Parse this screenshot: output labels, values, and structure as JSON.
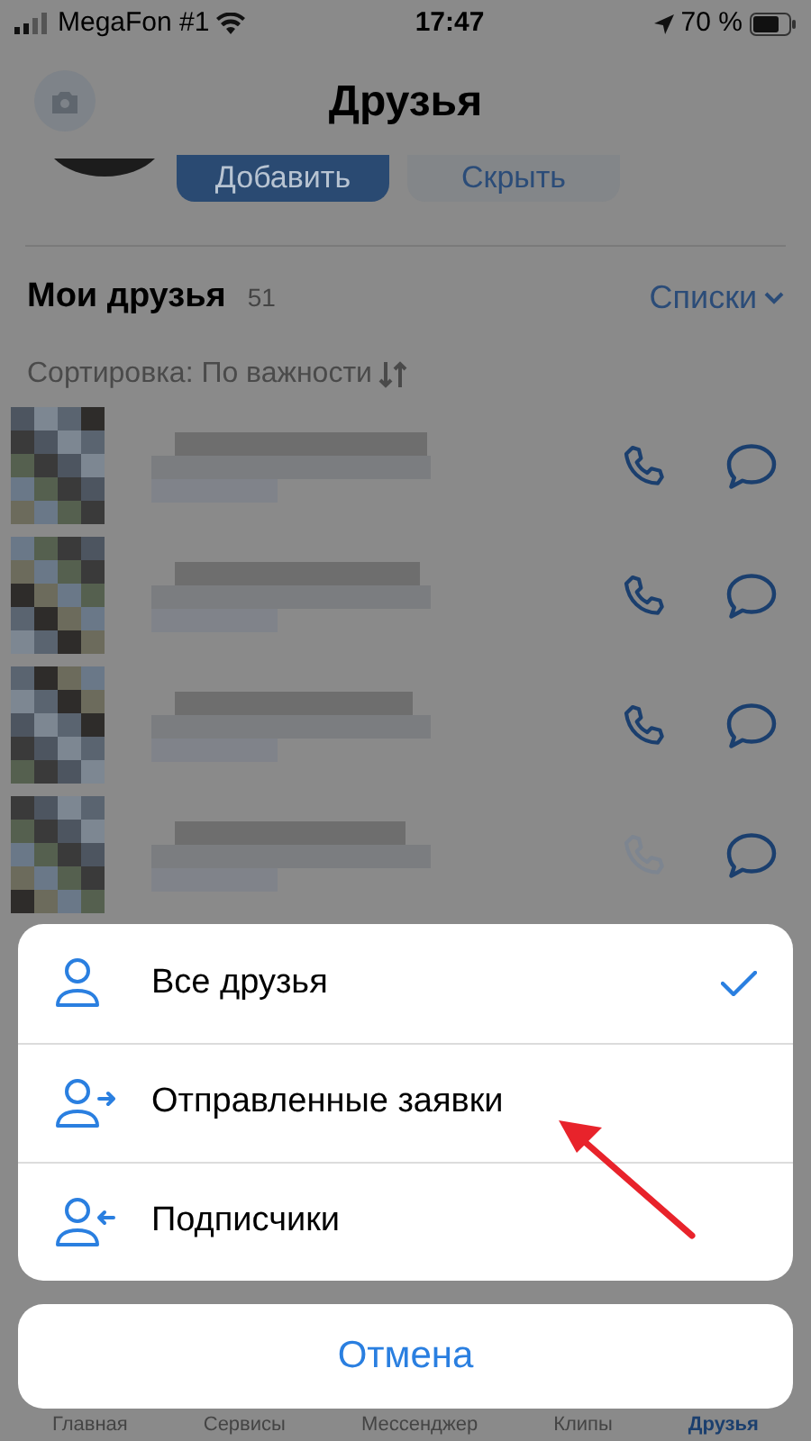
{
  "status_bar": {
    "carrier": "MegaFon #1",
    "time": "17:47",
    "battery": "70 %"
  },
  "header": {
    "title": "Друзья"
  },
  "request_buttons": [
    {
      "label": "Добавить",
      "kind": "primary"
    },
    {
      "label": "Скрыть",
      "kind": "secondary"
    }
  ],
  "friends_section": {
    "title": "Мои друзья",
    "count": "51",
    "lists_link": "Списки",
    "sort": "Сортировка: По важности"
  },
  "friends": [
    {
      "call_available": true
    },
    {
      "call_available": true
    },
    {
      "call_available": true
    },
    {
      "call_available": false
    }
  ],
  "action_sheet": {
    "items": [
      {
        "label": "Все друзья",
        "kind": "all",
        "checked": true
      },
      {
        "label": "Отправленные заявки",
        "kind": "sent",
        "checked": false
      },
      {
        "label": "Подписчики",
        "kind": "followers",
        "checked": false
      }
    ],
    "cancel": "Отмена"
  },
  "tab_bar": [
    {
      "label": "Главная",
      "selected": false
    },
    {
      "label": "Сервисы",
      "selected": false
    },
    {
      "label": "Мессенджер",
      "selected": false
    },
    {
      "label": "Клипы",
      "selected": false
    },
    {
      "label": "Друзья",
      "selected": true
    }
  ]
}
